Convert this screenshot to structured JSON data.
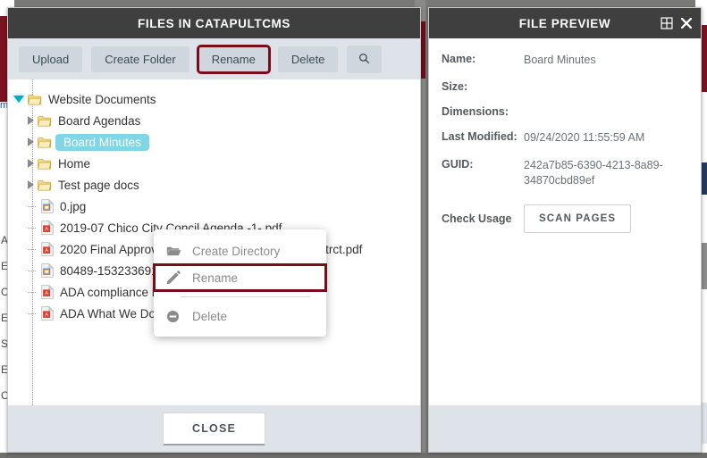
{
  "files_modal": {
    "title": "FILES IN CATAPULTCMS",
    "toolbar": {
      "upload_label": "Upload",
      "create_folder_label": "Create Folder",
      "rename_label": "Rename",
      "delete_label": "Delete",
      "search_icon": "search-icon",
      "highlight_color": "#7b0d1b"
    },
    "tree": [
      {
        "label": "Website Documents",
        "type": "folder",
        "depth": 0,
        "state": "open",
        "selected": false
      },
      {
        "label": "Board Agendas",
        "type": "folder",
        "depth": 1,
        "state": "closed",
        "selected": false
      },
      {
        "label": "Board Minutes",
        "type": "folder",
        "depth": 1,
        "state": "closed",
        "selected": true
      },
      {
        "label": "Home",
        "type": "folder",
        "depth": 1,
        "state": "closed",
        "selected": false
      },
      {
        "label": "Test page docs",
        "type": "folder",
        "depth": 1,
        "state": "closed",
        "selected": false
      },
      {
        "label": "0.jpg",
        "type": "image",
        "depth": 1,
        "state": "leaf",
        "selected": false
      },
      {
        "label": "2019-07 Chico City Concil Agenda -1-.pdf",
        "type": "pdf",
        "depth": 1,
        "state": "leaf",
        "selected": false
      },
      {
        "label": "2020 Final Approval - Calexico Unified School Distrct.pdf",
        "type": "pdf",
        "depth": 1,
        "state": "leaf",
        "selected": false
      },
      {
        "label": "80489-1532336916.jpg",
        "type": "image",
        "depth": 1,
        "state": "leaf",
        "selected": false
      },
      {
        "label": "ADA compliance Plans 12.5.18 2.pdf",
        "type": "pdf",
        "depth": 1,
        "state": "leaf",
        "selected": false
      },
      {
        "label": "ADA What We Do - what you do -1-.pdf",
        "type": "pdf",
        "depth": 1,
        "state": "leaf",
        "selected": false
      }
    ],
    "context_menu": [
      {
        "label": "Create Directory",
        "icon": "folder-open-icon",
        "highlighted": false
      },
      {
        "label": "Rename",
        "icon": "pencil-icon",
        "highlighted": true
      },
      {
        "label": "Delete",
        "icon": "minus-circle-icon",
        "highlighted": false
      }
    ],
    "footer": {
      "close_label": "CLOSE"
    }
  },
  "preview_modal": {
    "title": "FILE PREVIEW",
    "header_icons": [
      {
        "name": "expand-icon",
        "glyph": "⊞"
      },
      {
        "name": "close-icon",
        "glyph": "✖"
      }
    ],
    "fields": [
      {
        "label": "Name:",
        "value": "Board Minutes"
      },
      {
        "label": "Size:",
        "value": ""
      },
      {
        "label": "Dimensions:",
        "value": ""
      },
      {
        "label": "Last Modified:",
        "value": "09/24/2020 11:55:59 AM"
      },
      {
        "label": "GUID:",
        "value": "242a7b85-6390-4213-8a89-34870cbd89ef"
      }
    ],
    "check_usage": {
      "label": "Check Usage",
      "button_label": "SCAN PAGES"
    }
  },
  "background": {
    "left_letters": "A E C E S E C",
    "left_word": "m"
  }
}
